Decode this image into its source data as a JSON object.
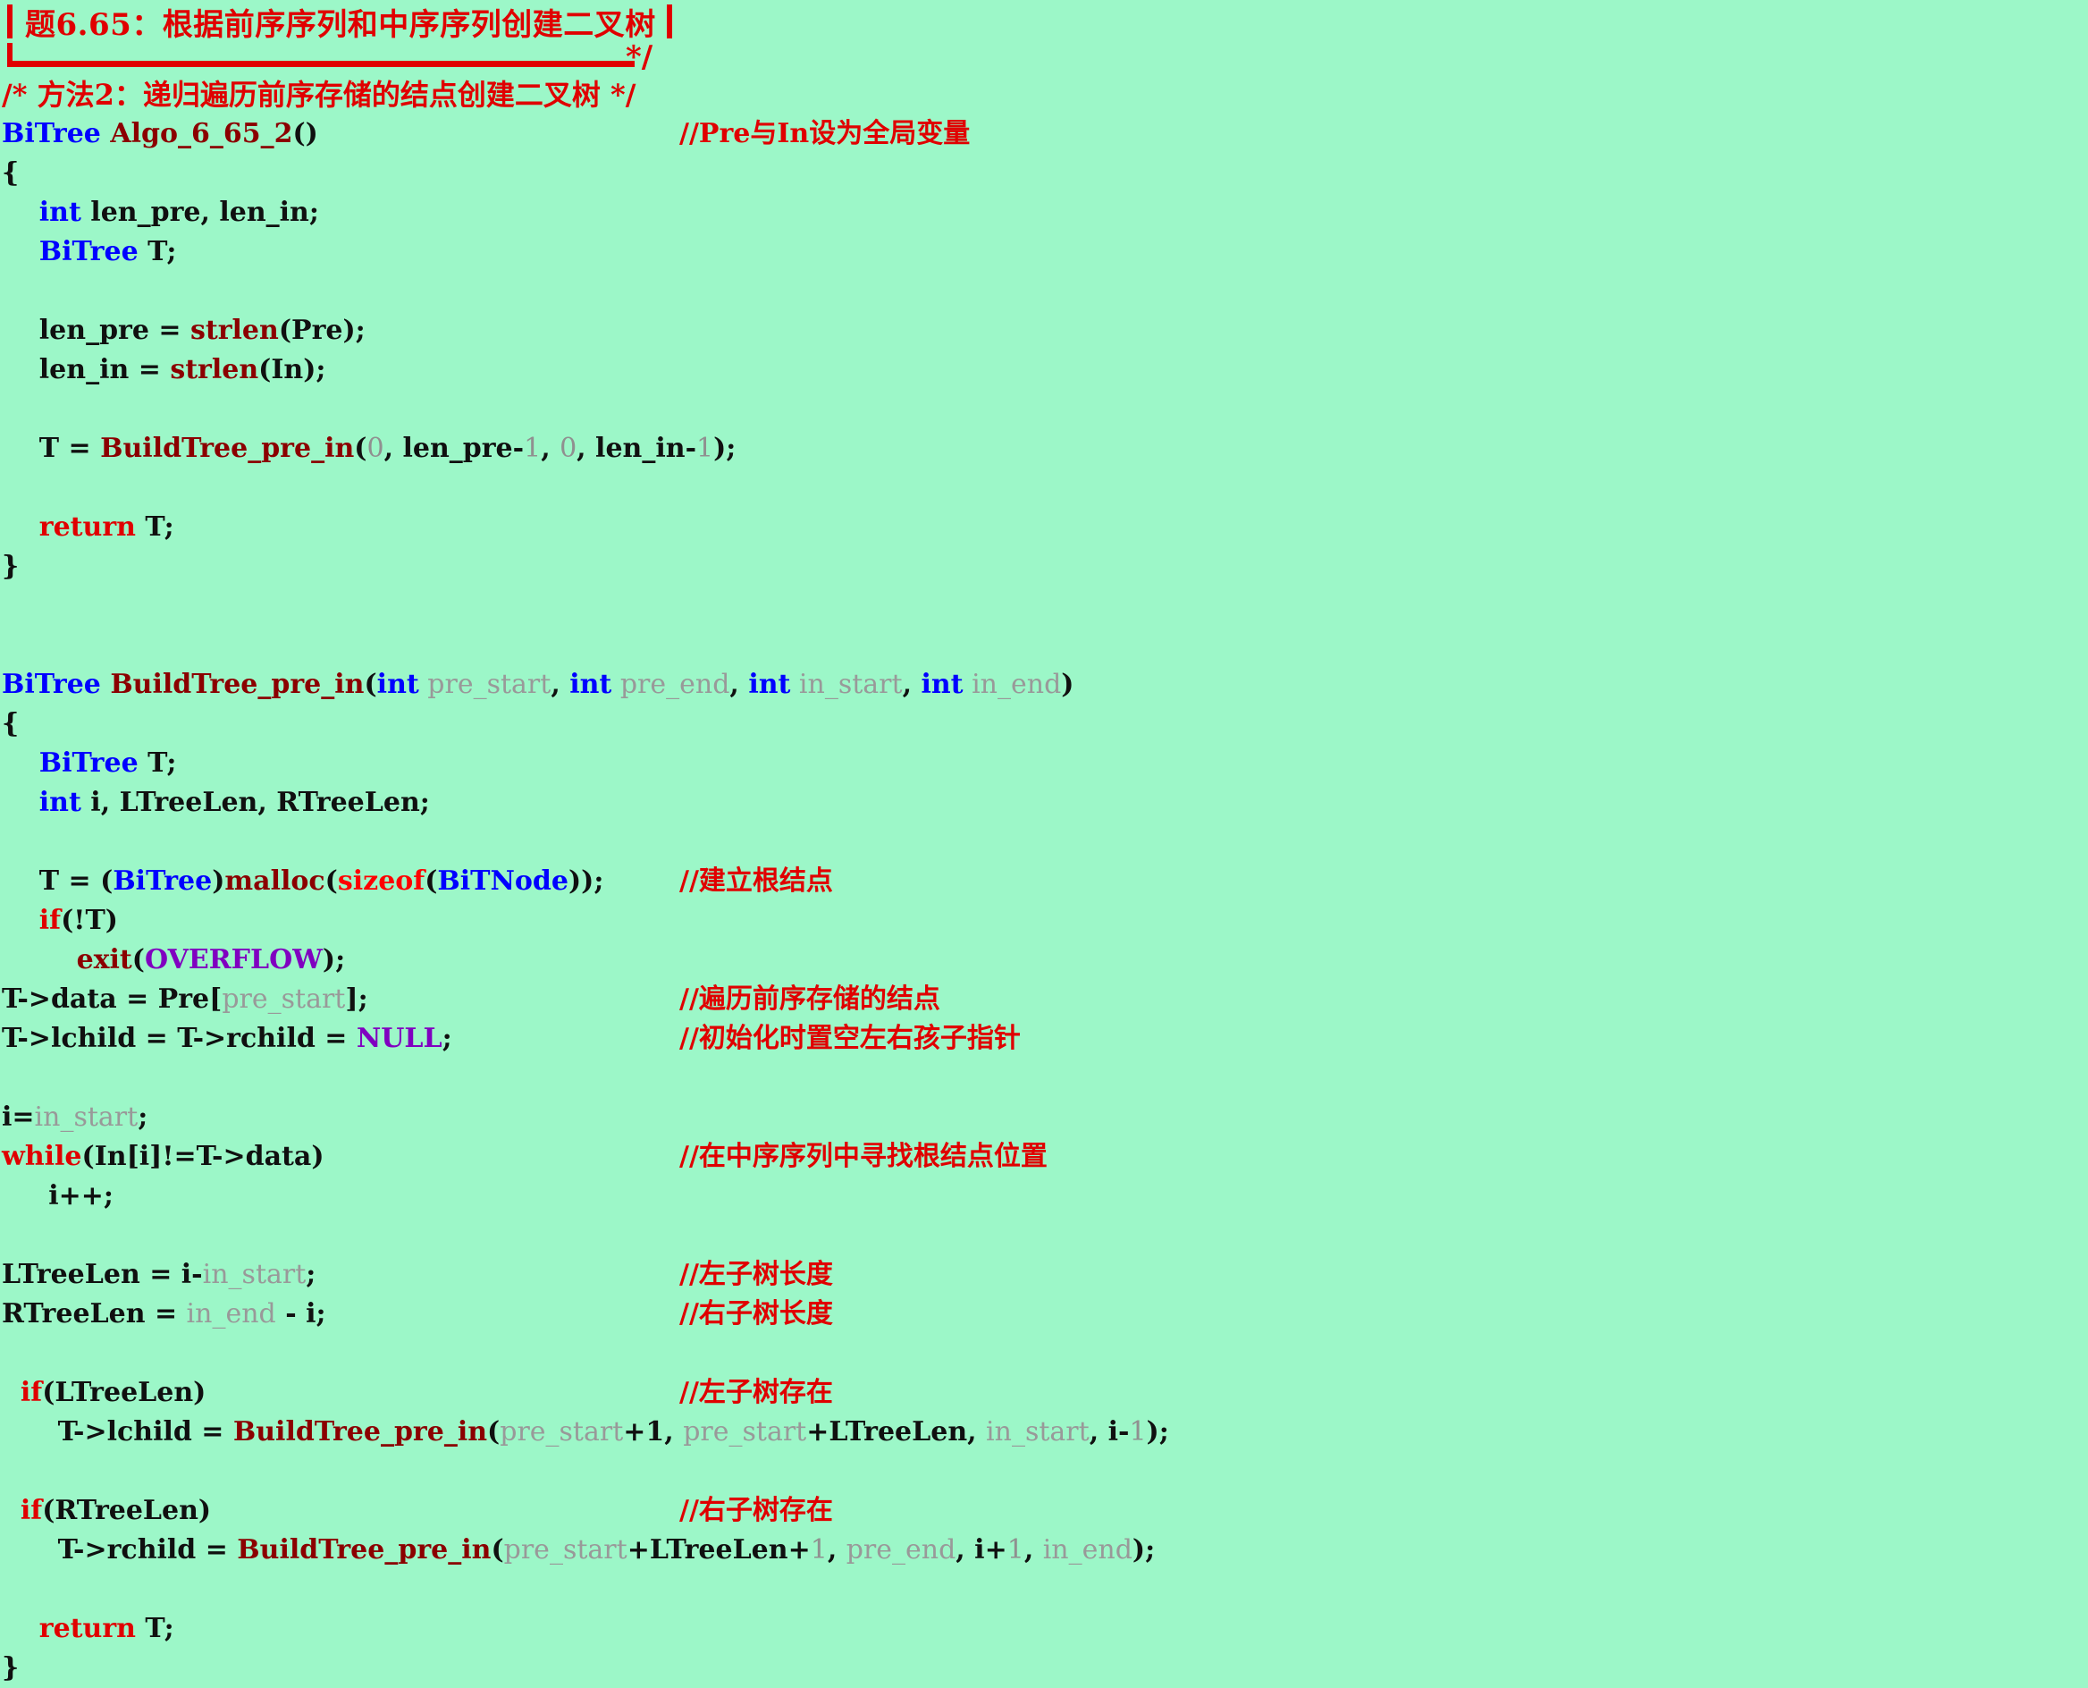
{
  "page": {
    "background_color": "#9cf7c8",
    "title_color": "#e00000"
  },
  "title_banner": {
    "heading": "题6.65：根据前序序列和中序序列创建二叉树",
    "rule_end": "*/"
  },
  "block_comment": "/* 方法2：递归遍历前序存储的结点创建二叉树 */",
  "colors": {
    "keyword_type": "#0000ff",
    "keyword_control": "#e00000",
    "function_name": "#8b0000",
    "sizeof": "#ff0000",
    "number": "#909090",
    "parameter": "#999999",
    "macro": "#8000c0",
    "plain": "#101010",
    "comment": "#e00000"
  },
  "code": {
    "func1_signature_type": "BiTree",
    "func1_signature_name": "Algo_6_65_2",
    "func1_signature_parens": "()",
    "func1_comment": "//Pre与In设为全局变量",
    "brace_open": "{",
    "brace_close": "}",
    "decl_int": "int",
    "decl_int_names": " len_pre, len_in;",
    "decl_bitree": "BiTree",
    "decl_bitree_names": " T;",
    "len_pre_lhs": "len_pre = ",
    "strlen": "strlen",
    "len_pre_args": "(Pre);",
    "len_in_lhs": "len_in = ",
    "len_in_args": "(In);",
    "build_call_lhs": "T = ",
    "build_fn": "BuildTree_pre_in",
    "build_p1": "(",
    "build_n0a": "0",
    "build_t1": ", len_pre-",
    "build_n1a": "1",
    "build_t2": ", ",
    "build_n0b": "0",
    "build_t3": ", len_in-",
    "build_n1b": "1",
    "build_t4": ");",
    "return_kw": "return",
    "return_val": " T;",
    "sig2_type": "BiTree",
    "sig2_name": " BuildTree_pre_in",
    "sig2_open": "(",
    "sig2_int1": "int",
    "sig2_p1": " pre_start",
    "sig2_c1": ", ",
    "sig2_int2": "int",
    "sig2_p2": " pre_end",
    "sig2_c2": ", ",
    "sig2_int3": "int",
    "sig2_p3": " in_start",
    "sig2_c3": ", ",
    "sig2_int4": "int",
    "sig2_p4": " in_end",
    "sig2_close": ")",
    "decl2_bitree": "BiTree",
    "decl2_bitree_names": " T;",
    "decl2_int": "int",
    "decl2_int_names": " i, LTreeLen, RTreeLen;",
    "malloc_lhs": "T = (",
    "malloc_type1": "BiTree",
    "malloc_mid1": ")",
    "malloc_fn": "malloc",
    "malloc_open": "(",
    "malloc_sizeof": "sizeof",
    "malloc_open2": "(",
    "malloc_type2": "BiTNode",
    "malloc_close": "));",
    "malloc_comment": "//建立根结点",
    "if_not_t_kw": "if",
    "if_not_t_rest": "(!T)",
    "exit_fn": "exit",
    "exit_open": "(",
    "exit_macro": "OVERFLOW",
    "exit_close": ");",
    "data_assign_pre": "T->data = Pre[",
    "data_assign_param": "pre_start",
    "data_assign_post": "];",
    "data_assign_comment": "//遍历前序存储的结点",
    "null_assign_pre": "T->lchild = T->rchild = ",
    "null_macro": "NULL",
    "null_assign_post": ";",
    "null_assign_comment": "//初始化时置空左右孩子指针",
    "i_init_pre": "i=",
    "i_init_param": "in_start",
    "i_init_post": ";",
    "while_kw": "while",
    "while_cond": "(In[i]!=T->data)",
    "while_comment": "//在中序序列中寻找根结点位置",
    "i_incr": "i++;",
    "ltreelen_pre": "LTreeLen = i-",
    "ltreelen_param": "in_start",
    "ltreelen_post": ";",
    "ltreelen_comment": "//左子树长度",
    "rtreelen_pre": "RTreeLen = ",
    "rtreelen_param": "in_end",
    "rtreelen_post": " - i;",
    "rtreelen_comment": "//右子树长度",
    "if_ltreelen_kw": "if",
    "if_ltreelen_rest": "(LTreeLen)",
    "if_ltreelen_comment": "//左子树存在",
    "lchild_lhs": "T->lchild = ",
    "lchild_fn": "BuildTree_pre_in",
    "lchild_open": "(",
    "lchild_a1": "pre_start",
    "lchild_t1": "+1, ",
    "lchild_a2": "pre_start",
    "lchild_t2": "+LTreeLen, ",
    "lchild_a3": "in_start",
    "lchild_t3": ", i-",
    "lchild_n1": "1",
    "lchild_close": ");",
    "if_rtreelen_kw": "if",
    "if_rtreelen_rest": "(RTreeLen)",
    "if_rtreelen_comment": "//右子树存在",
    "rchild_lhs": "T->rchild = ",
    "rchild_fn": "BuildTree_pre_in",
    "rchild_open": "(",
    "rchild_a1": "pre_start",
    "rchild_t1": "+LTreeLen+",
    "rchild_n1": "1",
    "rchild_t2": ", ",
    "rchild_a2": "pre_end",
    "rchild_t3": ", i+",
    "rchild_n2": "1",
    "rchild_t4": ", ",
    "rchild_a3": "in_end",
    "rchild_close": ");"
  }
}
